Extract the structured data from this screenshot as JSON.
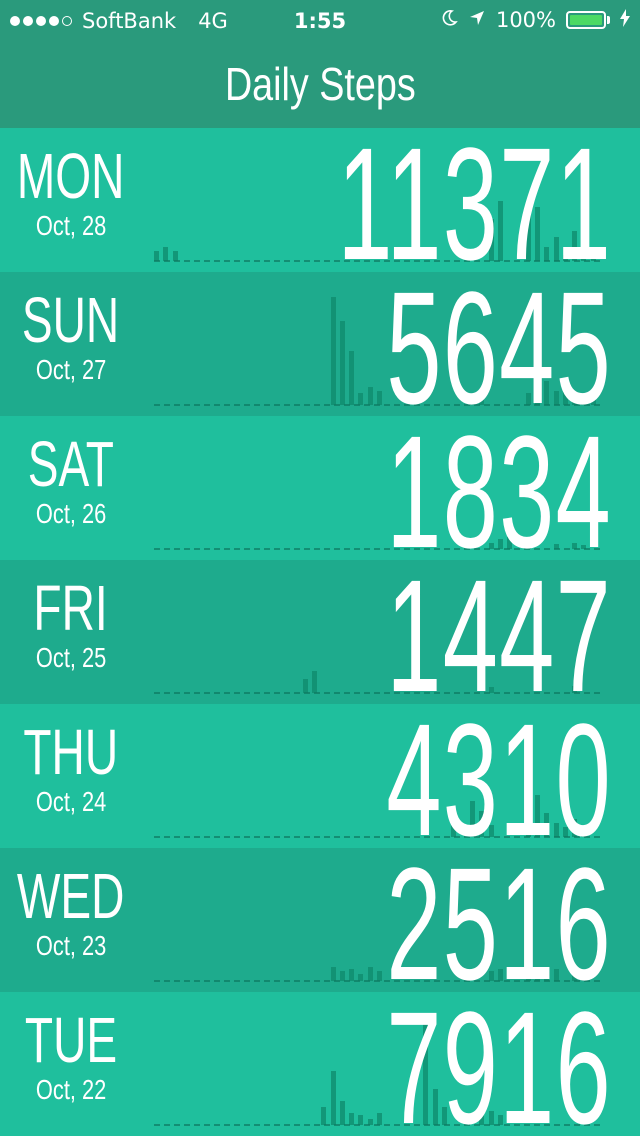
{
  "status_bar": {
    "carrier": "SoftBank",
    "network": "4G",
    "time": "1:55",
    "battery": "100%",
    "icons": [
      "moon-icon",
      "location-arrow-icon",
      "battery-icon",
      "charging-bolt-icon"
    ]
  },
  "header": {
    "title": "Daily Steps"
  },
  "days": [
    {
      "day": "MON",
      "date": "Oct, 28",
      "steps": "11371",
      "activity": [
        0.08,
        0.12,
        0.08,
        0,
        0,
        0,
        0,
        0,
        0,
        0,
        0,
        0,
        0,
        0,
        0,
        0,
        0,
        0,
        0,
        0,
        0,
        0,
        0,
        0,
        0,
        0,
        0,
        0,
        0,
        0,
        0,
        0,
        0,
        0,
        0,
        0,
        0.35,
        0.5,
        0,
        0,
        0.4,
        0.45,
        0.12,
        0.2,
        0.05,
        0.25,
        0.15,
        0.08
      ]
    },
    {
      "day": "SUN",
      "date": "Oct, 27",
      "steps": "5645",
      "activity": [
        0,
        0,
        0,
        0,
        0,
        0,
        0,
        0,
        0,
        0,
        0,
        0,
        0,
        0,
        0,
        0,
        0,
        0,
        0,
        0.9,
        0.7,
        0.45,
        0.1,
        0.15,
        0.12,
        0,
        0,
        0,
        0,
        0,
        0,
        0,
        0,
        0,
        0.08,
        0.1,
        0,
        0,
        0,
        0,
        0.1,
        0.06,
        0.2,
        0.12,
        0.15,
        0.1,
        0.08,
        0.05
      ]
    },
    {
      "day": "SAT",
      "date": "Oct, 26",
      "steps": "1834",
      "activity": [
        0,
        0,
        0,
        0,
        0,
        0,
        0,
        0,
        0,
        0,
        0,
        0,
        0,
        0,
        0,
        0,
        0,
        0,
        0,
        0,
        0,
        0,
        0,
        0,
        0,
        0,
        0,
        0,
        0,
        0,
        0,
        0,
        0,
        0,
        0,
        0,
        0.05,
        0.08,
        0.1,
        0,
        0.04,
        0,
        0,
        0.04,
        0,
        0.05,
        0.03,
        0
      ]
    },
    {
      "day": "FRI",
      "date": "Oct, 25",
      "steps": "1447",
      "activity": [
        0,
        0,
        0,
        0,
        0,
        0,
        0,
        0,
        0,
        0,
        0,
        0,
        0,
        0,
        0,
        0,
        0.12,
        0.18,
        0,
        0,
        0,
        0,
        0,
        0,
        0,
        0,
        0,
        0,
        0,
        0,
        0,
        0,
        0,
        0,
        0,
        0,
        0.05,
        0,
        0,
        0,
        0,
        0,
        0,
        0,
        0,
        0.06,
        0,
        0
      ]
    },
    {
      "day": "THU",
      "date": "Oct, 24",
      "steps": "4310",
      "activity": [
        0,
        0,
        0,
        0,
        0,
        0,
        0,
        0,
        0,
        0,
        0,
        0,
        0,
        0,
        0,
        0,
        0,
        0,
        0,
        0,
        0,
        0,
        0,
        0,
        0,
        0,
        0,
        0,
        0,
        0,
        0,
        0,
        0.2,
        0,
        0.3,
        0.22,
        0.1,
        0,
        0,
        0,
        0.1,
        0.35,
        0.2,
        0.12,
        0.08,
        0.15,
        0.1,
        0
      ]
    },
    {
      "day": "WED",
      "date": "Oct, 23",
      "steps": "2516",
      "activity": [
        0,
        0,
        0,
        0,
        0,
        0,
        0,
        0,
        0,
        0,
        0,
        0,
        0,
        0,
        0,
        0,
        0,
        0,
        0,
        0.12,
        0.08,
        0.1,
        0.06,
        0.12,
        0.08,
        0,
        0,
        0,
        0,
        0,
        0,
        0,
        0,
        0,
        0,
        0,
        0.08,
        0.1,
        0,
        0,
        0.12,
        0.1,
        0.05,
        0.1,
        0,
        0.08,
        0.05,
        0
      ]
    },
    {
      "day": "TUE",
      "date": "Oct, 22",
      "steps": "7916",
      "activity": [
        0,
        0,
        0,
        0,
        0,
        0,
        0,
        0,
        0,
        0,
        0,
        0,
        0,
        0,
        0,
        0,
        0,
        0,
        0.15,
        0.45,
        0.2,
        0.1,
        0.08,
        0.05,
        0.1,
        0,
        0,
        0,
        0,
        0.9,
        0.3,
        0.15,
        0,
        0,
        0,
        0.1,
        0.12,
        0.08,
        0,
        0,
        0,
        0,
        0,
        0,
        0,
        0,
        0,
        0
      ]
    }
  ]
}
